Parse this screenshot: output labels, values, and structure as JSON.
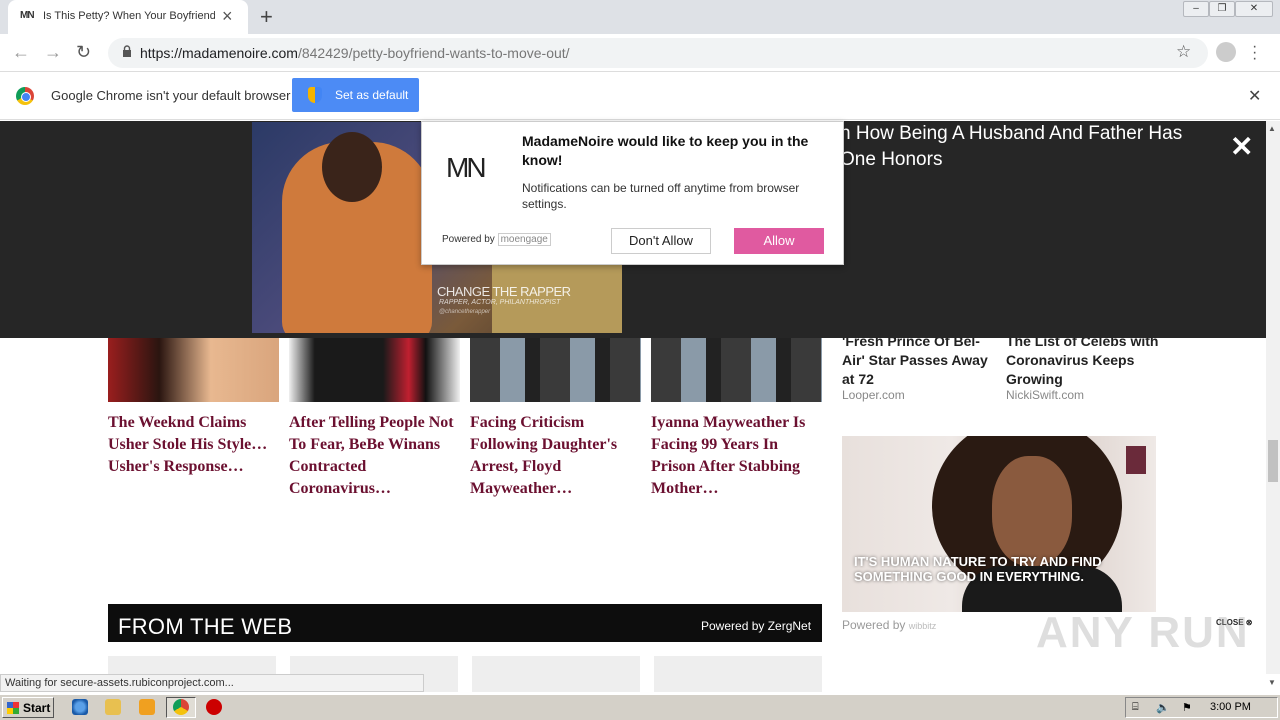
{
  "browser": {
    "tab_favicon": "MN",
    "tab_title": "Is This Petty? When Your Boyfriend",
    "url_host": "https://madamenoire.com",
    "url_path": "/842429/petty-boyfriend-wants-to-move-out/",
    "icons": [
      "back-arrow-icon",
      "forward-arrow-icon",
      "reload-icon",
      "lock-icon",
      "star-icon",
      "account-icon",
      "menu-icon",
      "close-icon",
      "plus-icon"
    ]
  },
  "infobar": {
    "message": "Google Chrome isn't your default browser",
    "button": "Set as default"
  },
  "notification": {
    "logo": "MN",
    "title": "MadameNoire would like to keep you in the know!",
    "description": "Notifications can be turned off anytime from browser settings.",
    "powered_by": "Powered by",
    "powered_brand": "moengage",
    "deny": "Don't Allow",
    "allow": "Allow"
  },
  "video_ad": {
    "caption": "CHANGE THE RAPPER",
    "subcaption": "RAPPER, ACTOR, PHILANTHROPIST",
    "handle": "@chancetherapper"
  },
  "overlay_headline": "n How Being A Husband And Father Has One Honors",
  "articles": [
    {
      "title": "The Weeknd Claims Usher Stole His Style…Usher's Response…"
    },
    {
      "title": "After Telling People Not To Fear, BeBe Winans Contracted Coronavirus…"
    },
    {
      "title": "Facing Criticism Following Daughter's Arrest, Floyd Mayweather…"
    },
    {
      "title": "Iyanna Mayweather Is Facing 99 Years In Prison After Stabbing Mother…"
    }
  ],
  "sidebar": [
    {
      "title": "'Fresh Prince Of Bel-Air' Star Passes Away at 72",
      "source": "Looper.com"
    },
    {
      "title": "The List of Celebs with Coronavirus Keeps Growing",
      "source": "NickiSwift.com"
    }
  ],
  "sidebar_ad": {
    "text": "IT'S HUMAN NATURE TO TRY AND FIND SOMETHING GOOD IN EVERYTHING.",
    "powered_by": "Powered by",
    "brand": "wibbitz",
    "close": "CLOSE"
  },
  "from_web": {
    "heading": "FROM THE WEB",
    "powered": "Powered by ZergNet"
  },
  "status_text": "Waiting for secure-assets.rubiconproject.com...",
  "watermark": "ANY RUN",
  "taskbar": {
    "start": "Start",
    "clock": "3:00 PM"
  }
}
